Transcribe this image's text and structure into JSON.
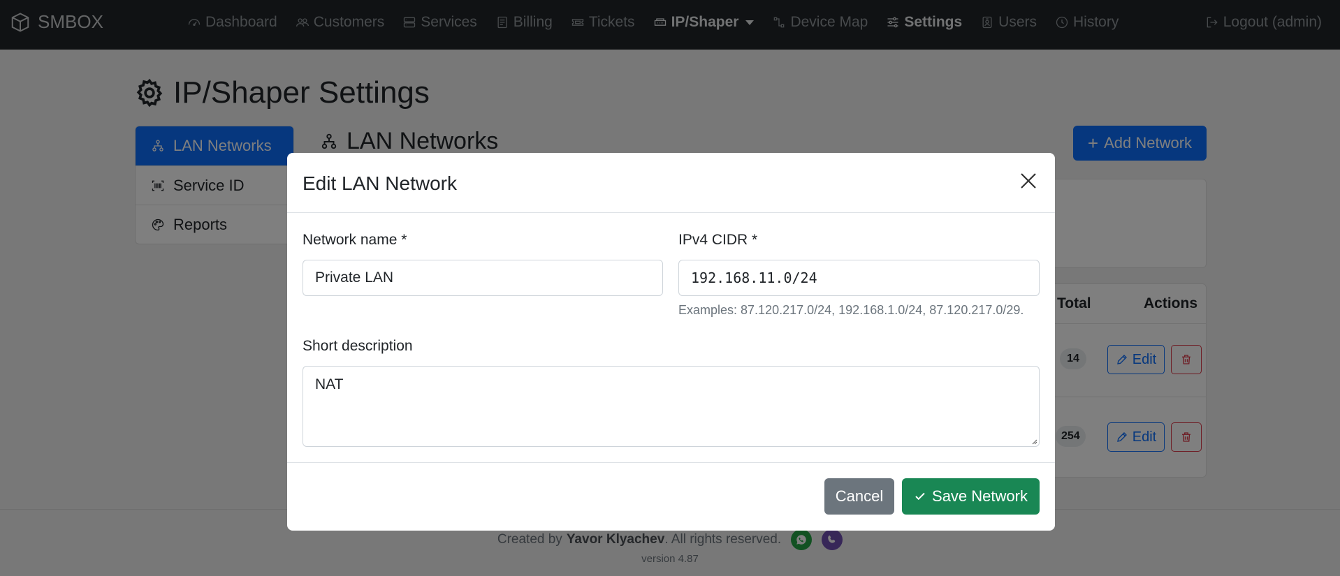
{
  "navbar": {
    "brand": "SMBOX",
    "items": [
      {
        "label": "Dashboard",
        "icon": "speedometer-icon"
      },
      {
        "label": "Customers",
        "icon": "people-icon"
      },
      {
        "label": "Services",
        "icon": "server-icon"
      },
      {
        "label": "Billing",
        "icon": "receipt-icon"
      },
      {
        "label": "Tickets",
        "icon": "ticket-icon"
      },
      {
        "label": "IP/Shaper",
        "icon": "ethernet-icon",
        "active": true,
        "dropdown": true
      },
      {
        "label": "Device Map",
        "icon": "diagram-icon"
      },
      {
        "label": "Settings",
        "icon": "sliders-icon",
        "active": true
      },
      {
        "label": "Users",
        "icon": "person-badge-icon"
      },
      {
        "label": "History",
        "icon": "clock-icon"
      }
    ],
    "logout": "Logout (admin)"
  },
  "page": {
    "title": "IP/Shaper Settings",
    "sidebar": [
      {
        "label": "LAN Networks",
        "icon": "diagram-icon",
        "active": true
      },
      {
        "label": "Service ID",
        "icon": "barcode-icon"
      },
      {
        "label": "Reports",
        "icon": "palette-icon"
      }
    ],
    "section_title": "LAN Networks",
    "add_button": "Add Network",
    "table": {
      "headers": {
        "total": "Total",
        "actions": "Actions"
      },
      "rows": [
        {
          "total": "14",
          "edit": "Edit"
        },
        {
          "total": "254",
          "edit": "Edit"
        }
      ]
    }
  },
  "modal": {
    "title": "Edit LAN Network",
    "name_label": "Network name *",
    "name_value": "Private LAN",
    "cidr_label": "IPv4 CIDR *",
    "cidr_value": "192.168.11.0/24",
    "cidr_help": "Examples: 87.120.217.0/24, 192.168.1.0/24, 87.120.217.0/29.",
    "desc_label": "Short description",
    "desc_value": "NAT",
    "cancel": "Cancel",
    "save": "Save Network"
  },
  "footer": {
    "created_by": "Created by",
    "author": "Yavor Klyachev",
    "rights": ". All rights reserved.",
    "version": "version 4.87"
  },
  "colors": {
    "primary": "#0d6efd",
    "success": "#198754",
    "secondary": "#6c757d",
    "danger": "#dc3545",
    "navbar": "#212529",
    "whatsapp": "#25a244",
    "viber": "#6f4fb0"
  }
}
